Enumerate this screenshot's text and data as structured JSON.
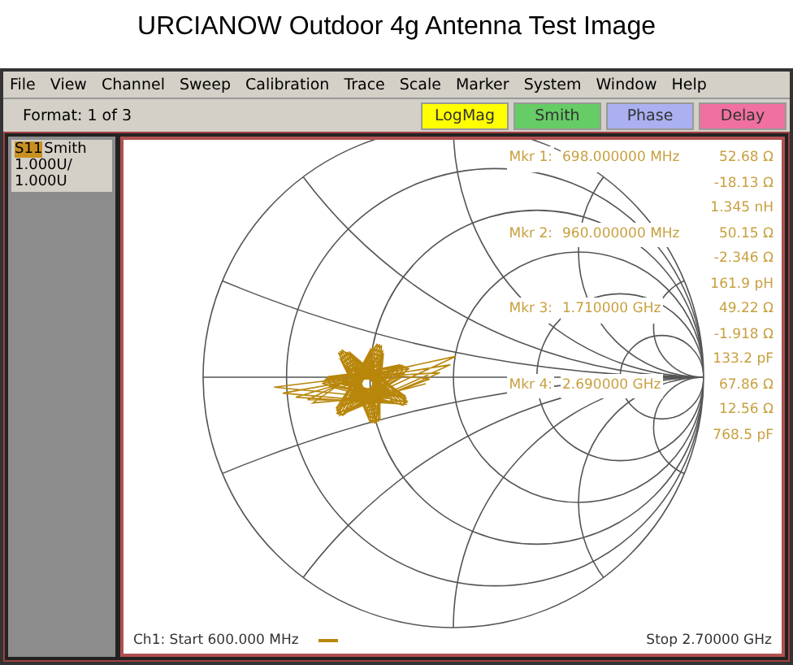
{
  "caption": "URCIANOW Outdoor 4g Antenna Test Image",
  "menu": [
    "File",
    "View",
    "Channel",
    "Sweep",
    "Calibration",
    "Trace",
    "Scale",
    "Marker",
    "System",
    "Window",
    "Help"
  ],
  "toolbar": {
    "format": "Format: 1 of 3",
    "buttons": [
      {
        "label": "LogMag",
        "color": "#ffff00"
      },
      {
        "label": "Smith",
        "color": "#66cc66"
      },
      {
        "label": "Phase",
        "color": "#aab0f0"
      },
      {
        "label": "Delay",
        "color": "#f070a0"
      }
    ]
  },
  "trace_panel": {
    "parameter": "S11",
    "format": "Smith",
    "lines": [
      "1.000U/",
      "1.000U"
    ]
  },
  "markers": [
    {
      "label": "Mkr 1:",
      "frequency": "698.000000 MHz",
      "values": [
        "52.68 Ω",
        "-18.13 Ω",
        "1.345 nH"
      ]
    },
    {
      "label": "Mkr 2:",
      "frequency": "960.000000 MHz",
      "values": [
        "50.15 Ω",
        "-2.346 Ω",
        "161.9 pH"
      ]
    },
    {
      "label": "Mkr 3:",
      "frequency": "1.710000 GHz",
      "values": [
        "49.22 Ω",
        "-1.918 Ω",
        "133.2 pF"
      ]
    },
    {
      "label": "Mkr 4:",
      "frequency": "2.690000 GHz",
      "values": [
        "67.86 Ω",
        "12.56 Ω",
        "768.5 pF"
      ]
    }
  ],
  "footer": {
    "start": "Ch1: Start  600.000 MHz",
    "stop": "Stop  2.70000 GHz"
  }
}
